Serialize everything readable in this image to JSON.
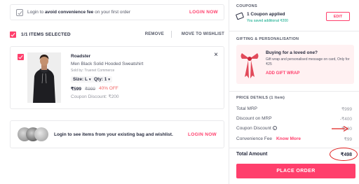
{
  "left": {
    "convenience": {
      "text_pre": "Login to ",
      "text_bold": "avoid convenience fee",
      "text_post": " on your first order",
      "link": "LOGIN NOW"
    },
    "selection": {
      "count_label": "1/1 ITEMS SELECTED",
      "remove_label": "REMOVE",
      "wishlist_label": "MOVE TO WISHLIST"
    },
    "item": {
      "brand": "Roadster",
      "name": "Men Black Solid Hooded Sweatshirt",
      "seller": "Sold by: Truenet Commerce",
      "size_label": "Size: L",
      "qty_label": "Qty: 1",
      "caret": "▾",
      "price": "₹599",
      "mrp": "₹999",
      "discount": "40% OFF",
      "coupon_discount": "Coupon Discount: ₹200",
      "close": "×"
    },
    "wishlist_prompt": {
      "text": "Login to see items from your existing bag and wishlist.",
      "link": "LOGIN NOW"
    }
  },
  "right": {
    "coupons": {
      "section_label": "COUPONS",
      "title": "1 Coupon applied",
      "subtitle": "You saved additional ₹200",
      "edit_label": "EDIT"
    },
    "gifting": {
      "section_label": "GIFTING & PERSONALISATION",
      "title": "Buying for a loved one?",
      "subtitle": "Gift wrap and personalised message on card, Only for ₹25",
      "link": "ADD GIFT WRAP"
    },
    "price_details": {
      "section_label": "PRICE DETAILS (1 Item)",
      "rows": [
        {
          "label": "Total MRP",
          "value": "₹999"
        },
        {
          "label": "Discount on MRP",
          "value": "-₹400"
        },
        {
          "label": "Coupon Discount",
          "value": "-₹200"
        },
        {
          "label": "Convenience Fee",
          "extra": "Know More",
          "value": "₹99"
        }
      ],
      "total_label": "Total Amount",
      "total_value": "₹498",
      "info_icon": "i"
    },
    "place_order_label": "PLACE ORDER"
  },
  "colors": {
    "accent": "#ff3f6c",
    "green": "#03a685",
    "annotation_red": "#e0201f"
  }
}
